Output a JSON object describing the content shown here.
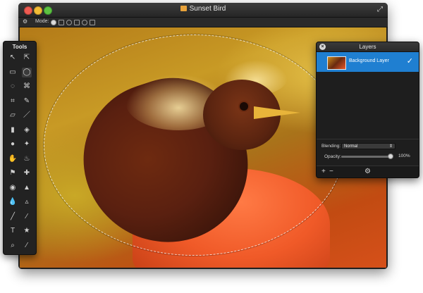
{
  "window": {
    "title": "Sunset Bird"
  },
  "modebar": {
    "mode_label": "Mode:",
    "gear_icon": "gear-icon"
  },
  "tools_panel": {
    "title": "Tools",
    "tools": [
      {
        "name": "move-tool",
        "glyph": "↖"
      },
      {
        "name": "direct-select-tool",
        "glyph": "⇱"
      },
      {
        "name": "rect-select-tool",
        "glyph": "▭"
      },
      {
        "name": "ellipse-select-tool",
        "glyph": "◯"
      },
      {
        "name": "lasso-tool",
        "glyph": "◌"
      },
      {
        "name": "poly-lasso-tool",
        "glyph": "⌘"
      },
      {
        "name": "crop-tool",
        "glyph": "⌗"
      },
      {
        "name": "eyedropper-tool",
        "glyph": "✎"
      },
      {
        "name": "eraser-tool",
        "glyph": "▱"
      },
      {
        "name": "pencil-tool",
        "glyph": "／"
      },
      {
        "name": "gradient-tool",
        "glyph": "▮"
      },
      {
        "name": "paint-bucket-tool",
        "glyph": "◈"
      },
      {
        "name": "shape-tool",
        "glyph": "●"
      },
      {
        "name": "brush-tool",
        "glyph": "✦"
      },
      {
        "name": "smudge-tool",
        "glyph": "✋"
      },
      {
        "name": "burn-tool",
        "glyph": "♨"
      },
      {
        "name": "clone-stamp-tool",
        "glyph": "⚑"
      },
      {
        "name": "heal-tool",
        "glyph": "✚"
      },
      {
        "name": "red-eye-tool",
        "glyph": "◉"
      },
      {
        "name": "sharpen-tool",
        "glyph": "▲"
      },
      {
        "name": "blur-tool",
        "glyph": "💧"
      },
      {
        "name": "sponge-tool",
        "glyph": "▵"
      },
      {
        "name": "pen-tool",
        "glyph": "╱"
      },
      {
        "name": "line-tool",
        "glyph": "∕"
      },
      {
        "name": "text-tool",
        "glyph": "T"
      },
      {
        "name": "custom-shape-tool",
        "glyph": "★"
      },
      {
        "name": "zoom-tool",
        "glyph": "⌕"
      },
      {
        "name": "color-picker-tool",
        "glyph": "⁄"
      }
    ]
  },
  "layers_panel": {
    "title": "Layers",
    "layer_name": "Background Layer",
    "blending_label": "Blending:",
    "blending_value": "Normal",
    "opacity_label": "Opacity:",
    "opacity_value": "100%",
    "opacity_fraction": 1.0,
    "add_label": "+",
    "remove_label": "−",
    "gear_label": "⚙"
  },
  "colors": {
    "selection_highlight": "#1f7fd1",
    "titlebar": "#2f2f2f"
  }
}
